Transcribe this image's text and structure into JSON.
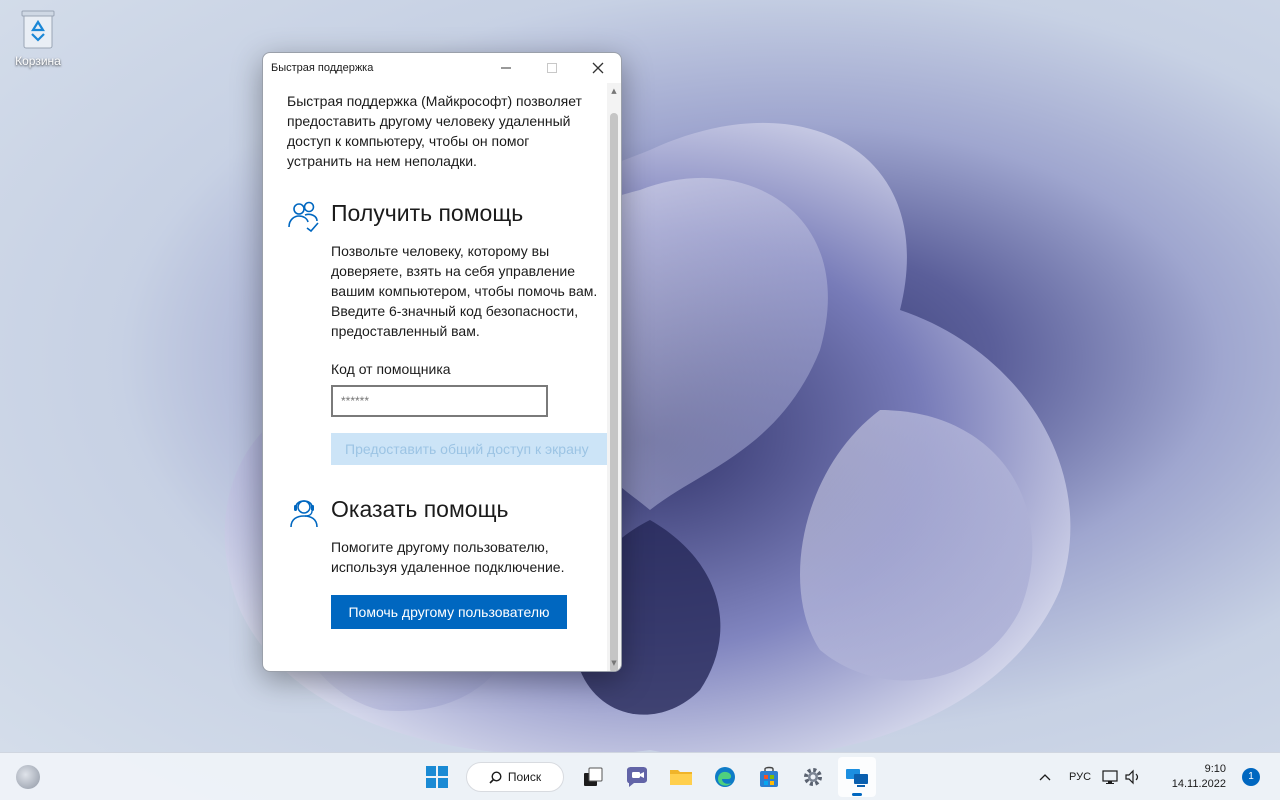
{
  "desktop": {
    "recycle_bin_label": "Корзина"
  },
  "window": {
    "title": "Быстрая поддержка",
    "intro": "Быстрая поддержка (Майкрософт) позволяет предоставить другому человеку удаленный доступ к компьютеру, чтобы он помог устранить на нем неполадки.",
    "get_help": {
      "heading": "Получить помощь",
      "description": "Позвольте человеку, которому вы доверяете, взять на себя управление вашим компьютером, чтобы помочь вам. Введите 6-значный код безопасности, предоставленный вам.",
      "code_label": "Код от помощника",
      "code_placeholder": "******",
      "share_button": "Предоставить общий доступ к экрану"
    },
    "give_help": {
      "heading": "Оказать помощь",
      "description": "Помогите другому пользователю, используя удаленное подключение.",
      "button": "Помочь другому пользователю"
    }
  },
  "taskbar": {
    "search_label": "Поиск",
    "language": "РУС",
    "time": "9:10",
    "date": "14.11.2022",
    "notification_count": "1",
    "accent_color": "#0067c0"
  }
}
